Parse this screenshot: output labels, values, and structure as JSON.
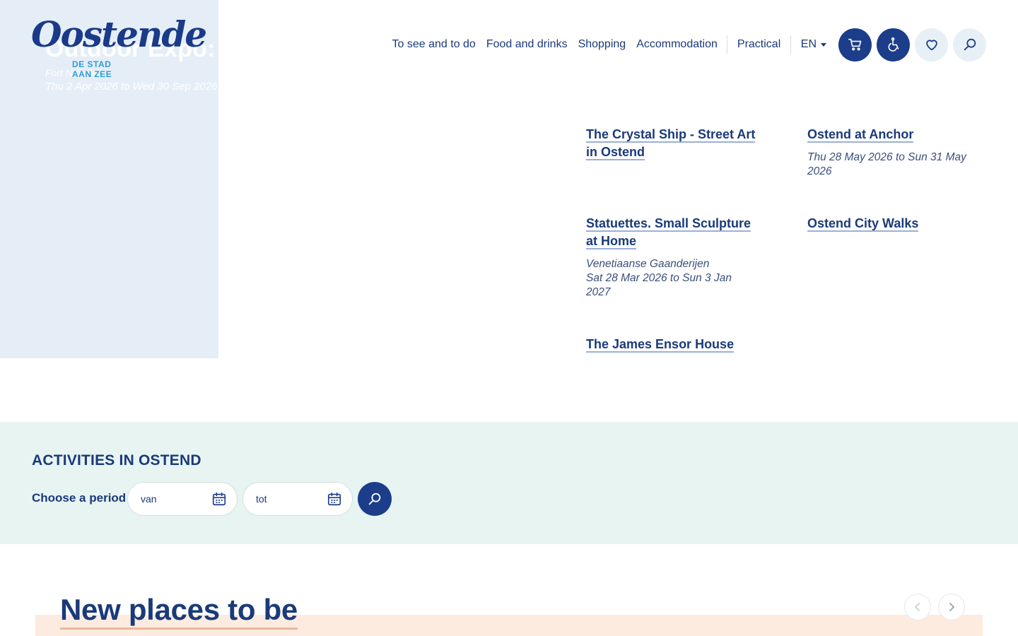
{
  "hero": {
    "title": "Outdoor Expo: Sub",
    "place": "Fort Napoleon",
    "date": "Thu 2 Apr 2026 to Wed 30 Sep 2026"
  },
  "logo": {
    "wordmark": "Oostende",
    "tagline_line1": "DE STAD",
    "tagline_line2": "AAN ZEE",
    "colors": {
      "wordmark": "#1a3a8a",
      "tagline": "#2f9bd8"
    }
  },
  "nav": {
    "items": [
      "To see and to do",
      "Food and drinks",
      "Shopping",
      "Accommodation"
    ],
    "practical": "Practical",
    "language": "EN",
    "icons": [
      "cart-icon",
      "accessibility-icon",
      "heart-icon",
      "search-icon"
    ]
  },
  "items": [
    {
      "title": "The Crystal Ship - Street Art in Ostend",
      "meta": ""
    },
    {
      "title": "Ostend at Anchor",
      "meta": "Thu 28 May 2026 to Sun 31 May 2026"
    },
    {
      "title": "Statuettes. Small Sculpture at Home",
      "meta_place": "Venetiaanse Gaanderijen",
      "meta": "Sat 28 Mar 2026 to Sun 3 Jan 2027"
    },
    {
      "title": "Ostend City Walks",
      "meta": ""
    },
    {
      "title": "The James Ensor House",
      "meta": ""
    }
  ],
  "activities": {
    "title": "ACTIVITIES IN OSTEND",
    "period_label": "Choose a period",
    "from_placeholder": "van",
    "to_placeholder": "tot",
    "background": "#e7f4f1"
  },
  "new_places": {
    "title": "New places to be"
  },
  "colors": {
    "brand": "#1b3d8a",
    "text": "#1a3a7a",
    "hero_panel": "#e5eef6",
    "peach": "#fdebdf"
  }
}
